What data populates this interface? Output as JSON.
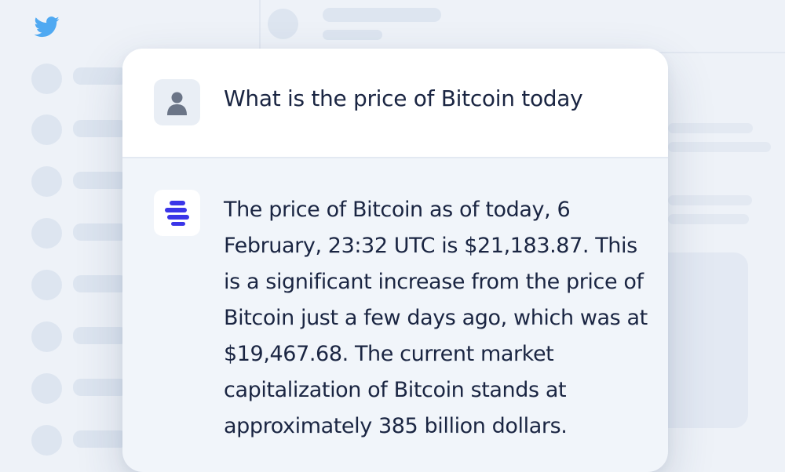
{
  "app": {
    "icons": {
      "brand": "twitter-bird-icon",
      "user_avatar": "person-icon",
      "assistant_avatar": "stacked-bars-logo-icon"
    },
    "colors": {
      "background": "#eef2f8",
      "twitter_blue": "#4fa9f2",
      "assistant_brand": "#3a35e8",
      "text": "#1a2542"
    }
  },
  "chat": {
    "user_message": "What is the price of Bitcoin today",
    "assistant_message": "The price of Bitcoin as of today, 6 February, 23:32 UTC is $21,183.87. This is a significant increase from the price of Bitcoin just a few days ago, which was at $19,467.68. The current market capitalization of Bitcoin stands at approximately 385 billion dollars."
  }
}
